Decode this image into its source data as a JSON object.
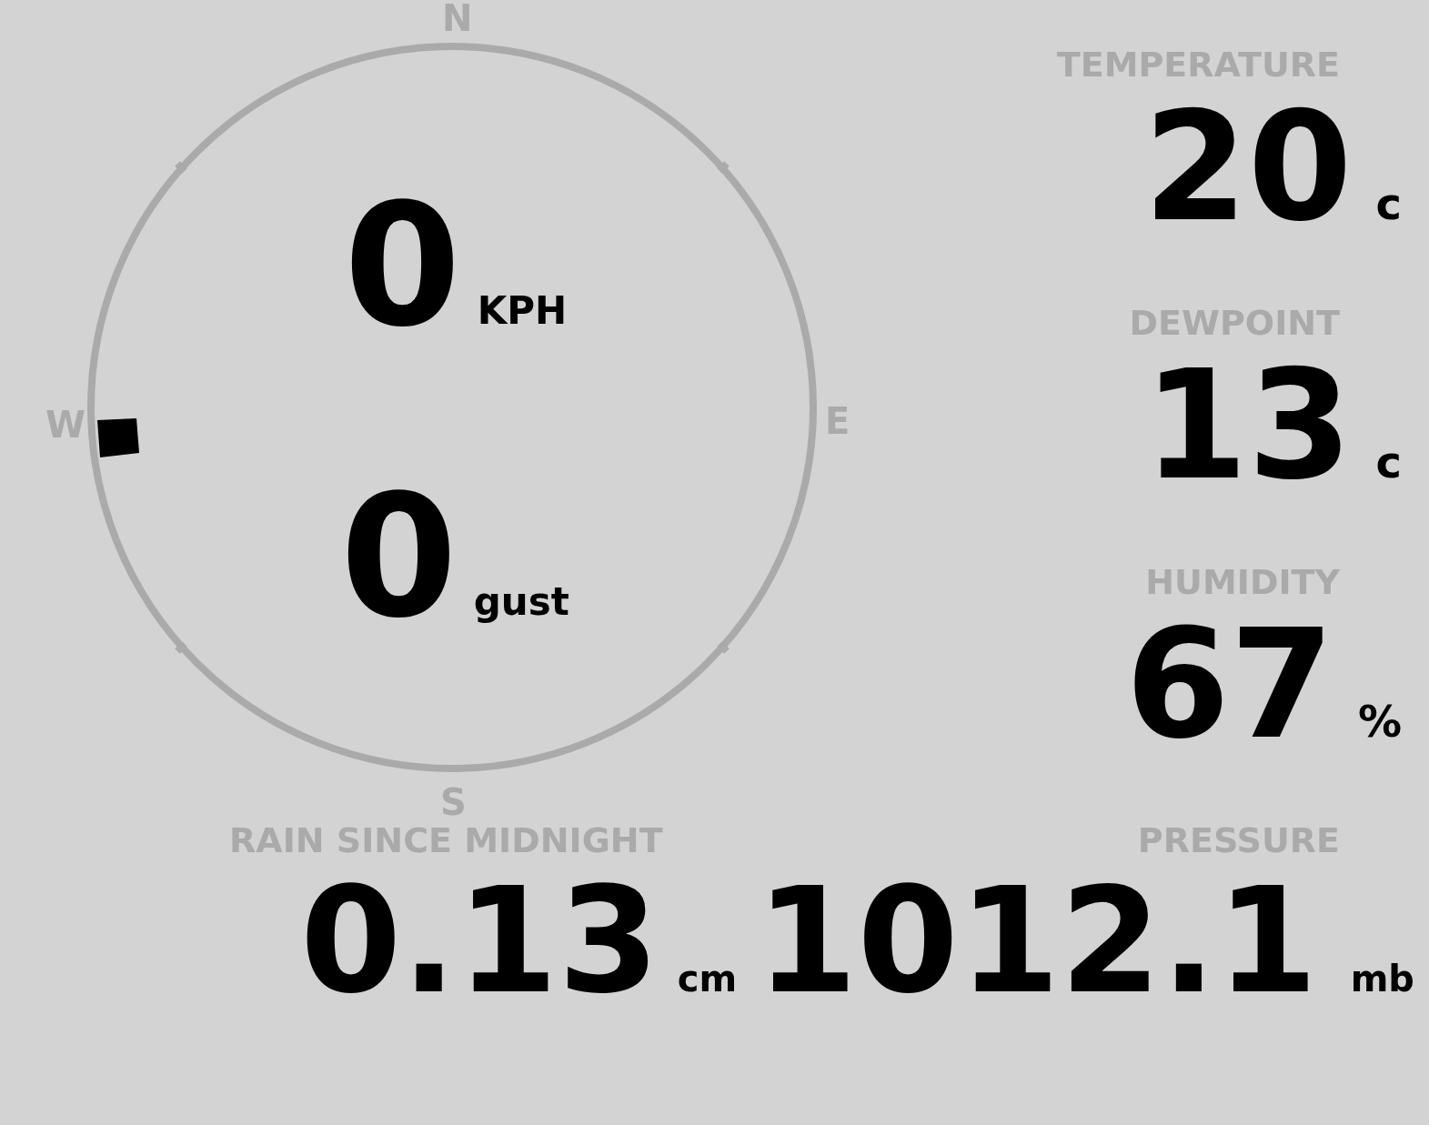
{
  "compass": {
    "north": "N",
    "east": "E",
    "south": "S",
    "west": "W"
  },
  "wind": {
    "speed": "0",
    "speed_unit": "KPH",
    "gust": "0",
    "gust_unit": "gust"
  },
  "readings": [
    {
      "label": "TEMPERATURE",
      "value": "20",
      "unit": "c"
    },
    {
      "label": "DEWPOINT",
      "value": "13",
      "unit": "c"
    },
    {
      "label": "HUMIDITY",
      "value": "67",
      "unit": "%"
    }
  ],
  "rain": {
    "label": "RAIN SINCE MIDNIGHT",
    "value": "0.13",
    "unit": "cm"
  },
  "pressure": {
    "label": "PRESSURE",
    "value": "1012.1",
    "unit": "mb"
  }
}
